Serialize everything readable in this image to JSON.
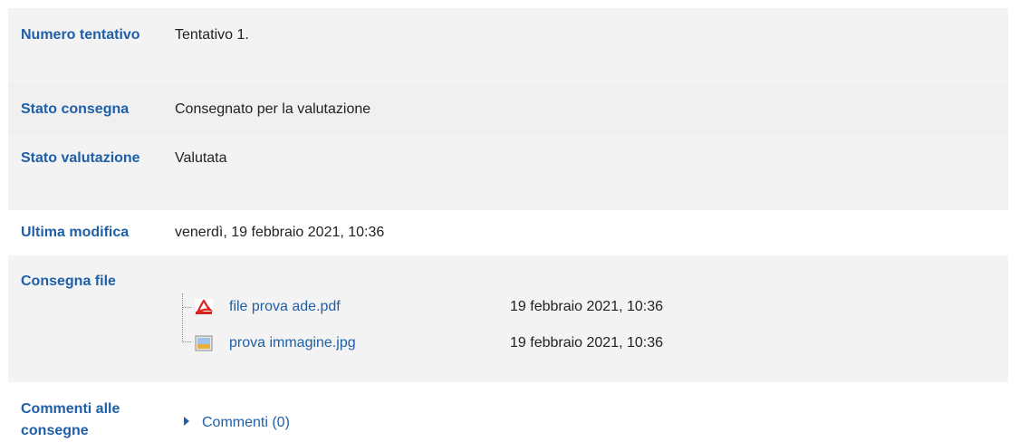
{
  "submission": {
    "attempt_number": {
      "label": "Numero tentativo",
      "value": "Tentativo 1."
    },
    "submission_status": {
      "label": "Stato consegna",
      "value": "Consegnato per la valutazione"
    },
    "grading_status": {
      "label": "Stato valutazione",
      "value": "Valutata"
    },
    "last_modified": {
      "label": "Ultima modifica",
      "value": "venerdì, 19 febbraio 2021, 10:36"
    },
    "file_submissions": {
      "label": "Consegna file",
      "files": [
        {
          "name": "file prova ade.pdf",
          "date": "19 febbraio 2021, 10:36",
          "icon": "pdf-file-icon"
        },
        {
          "name": "prova immagine.jpg",
          "date": "19 febbraio 2021, 10:36",
          "icon": "image-file-icon"
        }
      ]
    },
    "submission_comments": {
      "label": "Commenti alle consegne",
      "toggle": "Commenti (0)"
    }
  },
  "colors": {
    "label_blue": "#1f5fa8",
    "row_shade": "#f3f3f3",
    "pdf_red": "#d9231e"
  }
}
